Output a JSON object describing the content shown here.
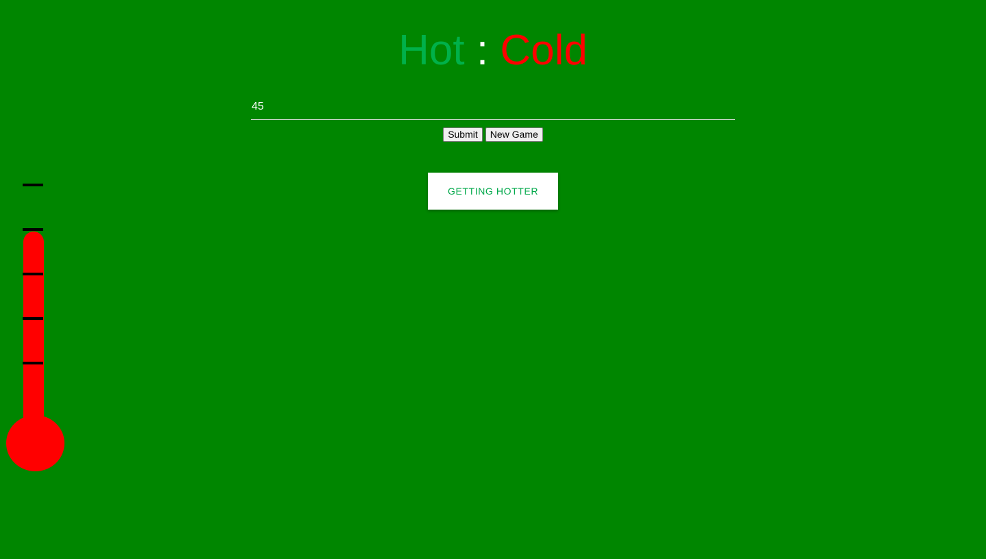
{
  "title": {
    "hot": "Hot",
    "separator": ":",
    "cold": "Cold"
  },
  "guess_input": {
    "value": "45"
  },
  "buttons": {
    "submit": "Submit",
    "new_game": "New Game"
  },
  "status": {
    "message": "GETTING HOTTER"
  },
  "thermometer": {
    "tick_count": 5
  },
  "colors": {
    "background": "#008600",
    "hot": "#00b14a",
    "cold": "#ff0000",
    "thermometer": "#ff0000"
  }
}
